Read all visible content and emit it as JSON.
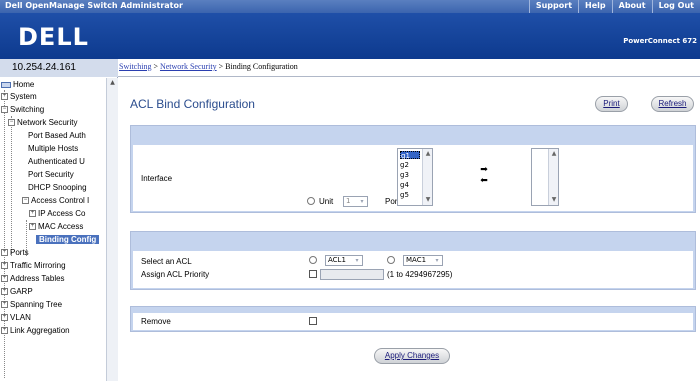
{
  "topbar": {
    "title": "Dell OpenManage Switch Administrator",
    "links": [
      "Support",
      "Help",
      "About",
      "Log Out"
    ]
  },
  "banner": {
    "logo": "DELL",
    "model": "PowerConnect 672"
  },
  "sidebar": {
    "ip": "10.254.24.161",
    "tree": [
      {
        "label": "Home"
      },
      {
        "label": "System"
      },
      {
        "label": "Switching"
      },
      {
        "label": "Network Security"
      },
      {
        "label": "Port Based Auth"
      },
      {
        "label": "Multiple Hosts"
      },
      {
        "label": "Authenticated U"
      },
      {
        "label": "Port Security"
      },
      {
        "label": "DHCP Snooping"
      },
      {
        "label": "Access Control I"
      },
      {
        "label": "IP Access Co"
      },
      {
        "label": "MAC Access"
      },
      {
        "label": "Binding Config"
      },
      {
        "label": "Ports"
      },
      {
        "label": "Traffic Mirroring"
      },
      {
        "label": "Address Tables"
      },
      {
        "label": "GARP"
      },
      {
        "label": "Spanning Tree"
      },
      {
        "label": "VLAN"
      },
      {
        "label": "Link Aggregation"
      }
    ]
  },
  "breadcrumb": {
    "item1": "Switching",
    "sep1": " > ",
    "item2": "Network Security",
    "sep2": " > ",
    "current": "Binding Configuration"
  },
  "page": {
    "title": "ACL Bind Configuration",
    "print_label": "Print",
    "refresh_label": "Refresh"
  },
  "interface_section": {
    "label": "Interface",
    "unit_label": "Unit",
    "unit_value": "1",
    "port_label": "Port",
    "port_options": [
      "g1",
      "g2",
      "g3",
      "g4",
      "g5"
    ],
    "port_selected": "g1",
    "add_arrow": "➡",
    "remove_arrow": "⬅"
  },
  "acl_section": {
    "select_acl_label": "Select an ACL",
    "ip_acl_value": "ACL1",
    "mac_acl_value": "MAC1",
    "priority_label": "Assign ACL Priority",
    "priority_range": "(1 to 4294967295)"
  },
  "remove_section": {
    "label": "Remove"
  },
  "apply_label": "Apply Changes"
}
